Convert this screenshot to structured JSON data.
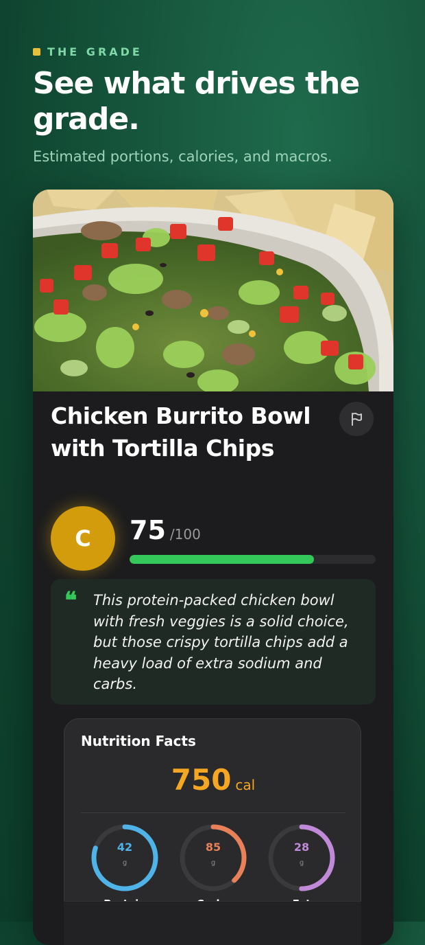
{
  "header": {
    "eyebrow": "THE GRADE",
    "headline": "See what drives the grade.",
    "subhead": "Estimated portions, calories, and macros."
  },
  "meal": {
    "title": "Chicken Burrito Bowl with Tortilla Chips",
    "grade_letter": "C",
    "score": "75",
    "score_max": "/100",
    "score_fraction": 0.75,
    "summary": "This protein-packed chicken bowl with fresh veggies is a solid choice, but those crispy tortilla chips add a heavy load of extra sodium and carbs."
  },
  "nutrition": {
    "title": "Nutrition Facts",
    "calories": "750",
    "calories_unit": "cal",
    "macros": [
      {
        "label": "Protein",
        "value": "42",
        "unit": "g",
        "color": "#4fb3e8",
        "fraction": 0.8
      },
      {
        "label": "Carbs",
        "value": "85",
        "unit": "g",
        "color": "#e8805a",
        "fraction": 0.38
      },
      {
        "label": "Fat",
        "value": "28",
        "unit": "g",
        "color": "#c08ad8",
        "fraction": 0.5
      }
    ]
  },
  "colors": {
    "accent_green": "#34c759",
    "grade_gold": "#d39c0c",
    "calorie_orange": "#f5a623"
  },
  "icons": {
    "flag": "flag-icon",
    "eyebrow": "square-dot-icon",
    "quote": "quote-icon"
  }
}
